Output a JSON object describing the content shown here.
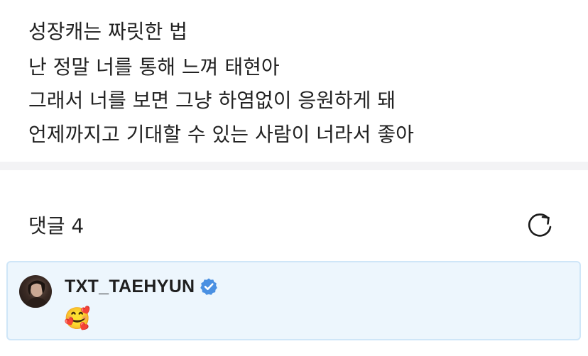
{
  "post": {
    "lines": [
      "성장캐는 짜릿한 법",
      "난 정말 너를 통해 느껴 태현아",
      "그래서 너를 보면 그냥 하염없이 응원하게 돼",
      "언제까지고 기대할 수 있는 사람이 너라서 좋아"
    ]
  },
  "comments": {
    "header_label": "댓글 4",
    "refresh_icon": "refresh-icon",
    "items": [
      {
        "author": "TXT_TAEHYUN",
        "verified": true,
        "verified_color": "#4a90e2",
        "text": "🥰"
      }
    ]
  },
  "colors": {
    "highlight_bg": "#edf6fd",
    "highlight_border": "#cfe6f8",
    "divider": "#f3f3f5"
  }
}
